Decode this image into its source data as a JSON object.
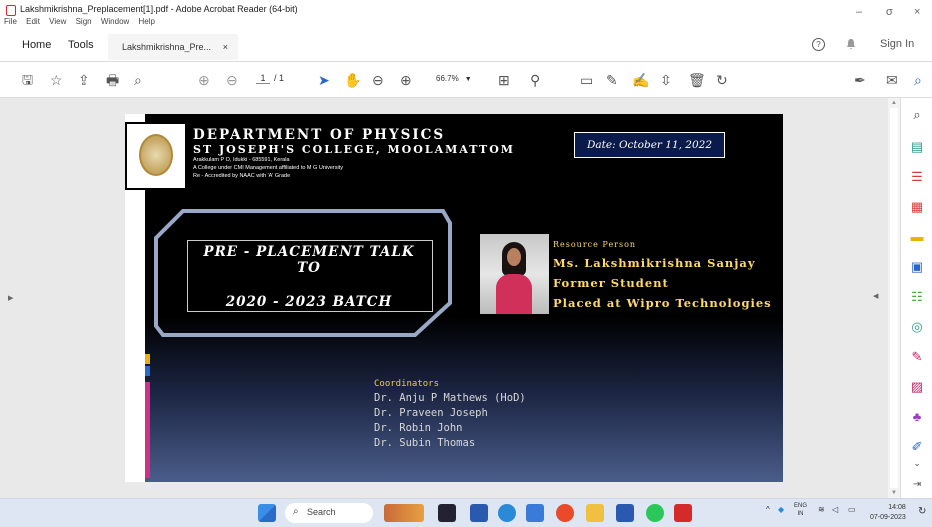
{
  "window": {
    "title": "Lakshmikrishna_Preplacement[1].pdf - Adobe Acrobat Reader (64-bit)",
    "menu": [
      "File",
      "Edit",
      "View",
      "Sign",
      "Window",
      "Help"
    ],
    "controls": {
      "minimize": "–",
      "maximize": "σ",
      "close": "×"
    }
  },
  "tabs": {
    "home": "Home",
    "tools": "Tools",
    "document": "Lakshmikrishna_Pre...",
    "document_close": "×",
    "help": "?",
    "sign_in": "Sign In"
  },
  "toolbar": {
    "page_current": "1",
    "page_total": "/ 1",
    "zoom": "66.7%"
  },
  "slide": {
    "department": "DEPARTMENT OF PHYSICS",
    "college": "ST JOSEPH'S COLLEGE, MOOLAMATTOM",
    "address_lines": [
      "Arakkulam P O, Idukki - 685591, Kerala",
      "A College under CMI Management affiliated to M G University",
      "Re - Accredited by NAAC with 'A' Grade"
    ],
    "date": "Date: October 11, 2022",
    "talk_line1": "PRE - PLACEMENT TALK",
    "talk_line2": "TO",
    "talk_line3": "2020 - 2023 BATCH",
    "resource_label": "Resource Person",
    "resource_lines": [
      "Ms. Lakshmikrishna Sanjay",
      "Former Student",
      "Placed at Wipro Technologies"
    ],
    "coordinators_title": "Coordinators",
    "coordinators": [
      "Dr. Anju P Mathews (HoD)",
      "Dr. Praveen Joseph",
      "Dr. Robin John",
      "Dr. Subin Thomas"
    ]
  },
  "taskbar": {
    "search": "Search",
    "lang_top": "ENG",
    "lang_bottom": "IN",
    "time": "14:08",
    "date": "07-09-2023"
  },
  "colors": {
    "accent_blue": "#2a66c8",
    "slide_gold": "#ffd966",
    "date_box_bg": "#0a1a4a"
  }
}
